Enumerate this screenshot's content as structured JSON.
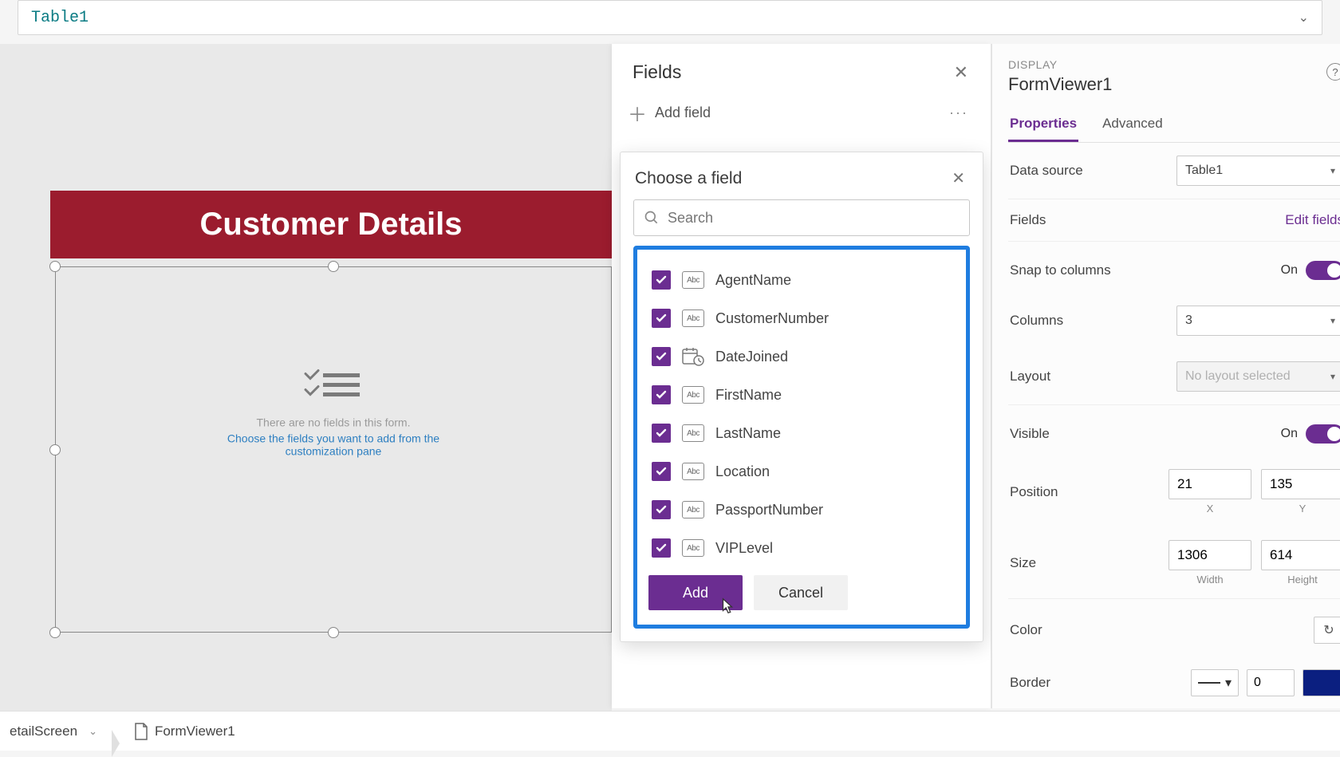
{
  "formulaBar": {
    "text": "Table1"
  },
  "canvas": {
    "title": "Customer Details",
    "emptyLine1": "There are no fields in this form.",
    "emptyLine2": "Choose the fields you want to add from the customization pane"
  },
  "breadcrumb": {
    "screen": "etailScreen",
    "control": "FormViewer1"
  },
  "fieldsPanel": {
    "title": "Fields",
    "addFieldLabel": "Add field",
    "moreLabel": "···",
    "choose": {
      "title": "Choose a field",
      "searchPlaceholder": "Search",
      "addLabel": "Add",
      "cancelLabel": "Cancel",
      "fields": [
        {
          "name": "AgentName",
          "type": "text",
          "checked": true
        },
        {
          "name": "CustomerNumber",
          "type": "text",
          "checked": true
        },
        {
          "name": "DateJoined",
          "type": "date",
          "checked": true
        },
        {
          "name": "FirstName",
          "type": "text",
          "checked": true
        },
        {
          "name": "LastName",
          "type": "text",
          "checked": true
        },
        {
          "name": "Location",
          "type": "text",
          "checked": true
        },
        {
          "name": "PassportNumber",
          "type": "text",
          "checked": true
        },
        {
          "name": "VIPLevel",
          "type": "text",
          "checked": true
        }
      ]
    }
  },
  "props": {
    "kicker": "DISPLAY",
    "objectName": "FormViewer1",
    "tabs": {
      "properties": "Properties",
      "advanced": "Advanced"
    },
    "dataSource": {
      "label": "Data source",
      "value": "Table1"
    },
    "fields": {
      "label": "Fields",
      "edit": "Edit fields"
    },
    "snap": {
      "label": "Snap to columns",
      "state": "On"
    },
    "columns": {
      "label": "Columns",
      "value": "3"
    },
    "layout": {
      "label": "Layout",
      "value": "No layout selected"
    },
    "visible": {
      "label": "Visible",
      "state": "On"
    },
    "position": {
      "label": "Position",
      "x": "21",
      "y": "135",
      "xLabel": "X",
      "yLabel": "Y"
    },
    "size": {
      "label": "Size",
      "w": "1306",
      "h": "614",
      "wLabel": "Width",
      "hLabel": "Height"
    },
    "color": {
      "label": "Color"
    },
    "border": {
      "label": "Border",
      "width": "0",
      "colorHex": "#0b1f80"
    }
  }
}
